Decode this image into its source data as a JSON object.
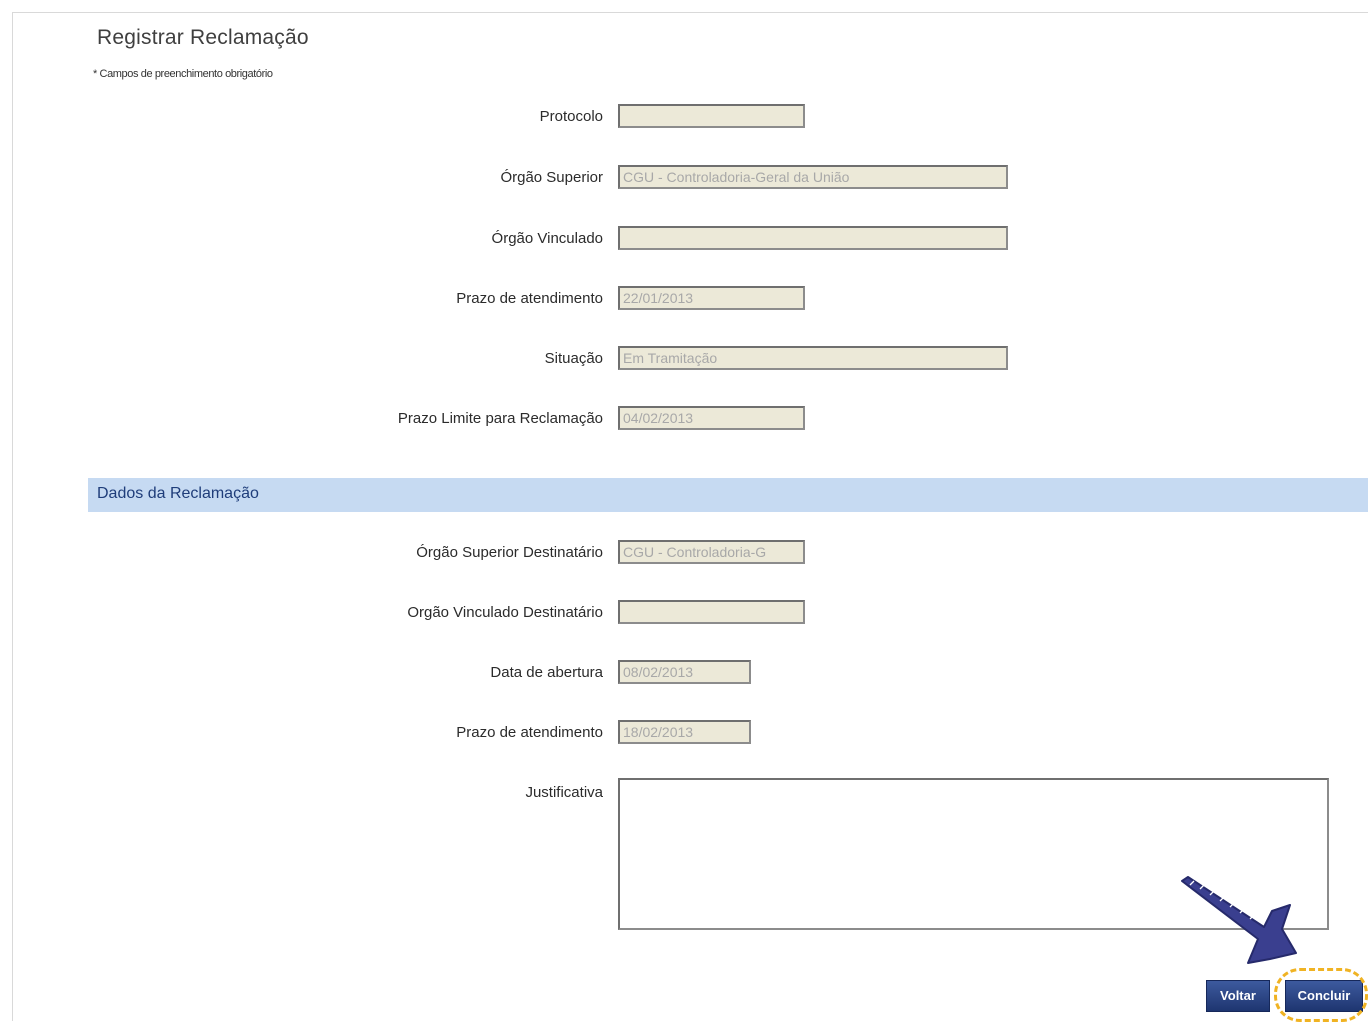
{
  "header": {
    "title": "Registrar Reclamação",
    "required_note": "* Campos de preenchimento obrigatório"
  },
  "fields": {
    "protocolo": {
      "label": "Protocolo",
      "value": ""
    },
    "orgao_superior": {
      "label": "Órgão Superior",
      "value": "CGU - Controladoria-Geral da União"
    },
    "orgao_vinculado": {
      "label": "Órgão Vinculado",
      "value": ""
    },
    "prazo_atendimento": {
      "label": "Prazo de atendimento",
      "value": "22/01/2013"
    },
    "situacao": {
      "label": "Situação",
      "value": "Em Tramitação"
    },
    "prazo_limite": {
      "label": "Prazo Limite para Reclamação",
      "value": "04/02/2013"
    }
  },
  "section": {
    "title": "Dados da Reclamação"
  },
  "reclamacao": {
    "orgao_superior_destinatario": {
      "label": "Órgão Superior Destinatário",
      "value": "CGU - Controladoria-G"
    },
    "orgao_vinculado_destinatario": {
      "label": "Orgão Vinculado Destinatário",
      "value": ""
    },
    "data_abertura": {
      "label": "Data de abertura",
      "value": "08/02/2013"
    },
    "prazo_atendimento": {
      "label": "Prazo de atendimento",
      "value": "18/02/2013"
    },
    "justificativa": {
      "label": "Justificativa",
      "value": ""
    }
  },
  "buttons": {
    "voltar": "Voltar",
    "concluir": "Concluir"
  },
  "colors": {
    "section_bar": "#c6daf2",
    "button": "#2a4585",
    "highlight": "#f0b323",
    "arrow": "#3a3f8f"
  },
  "icons": {
    "annotation_arrow": "arrow-pointer-icon"
  }
}
